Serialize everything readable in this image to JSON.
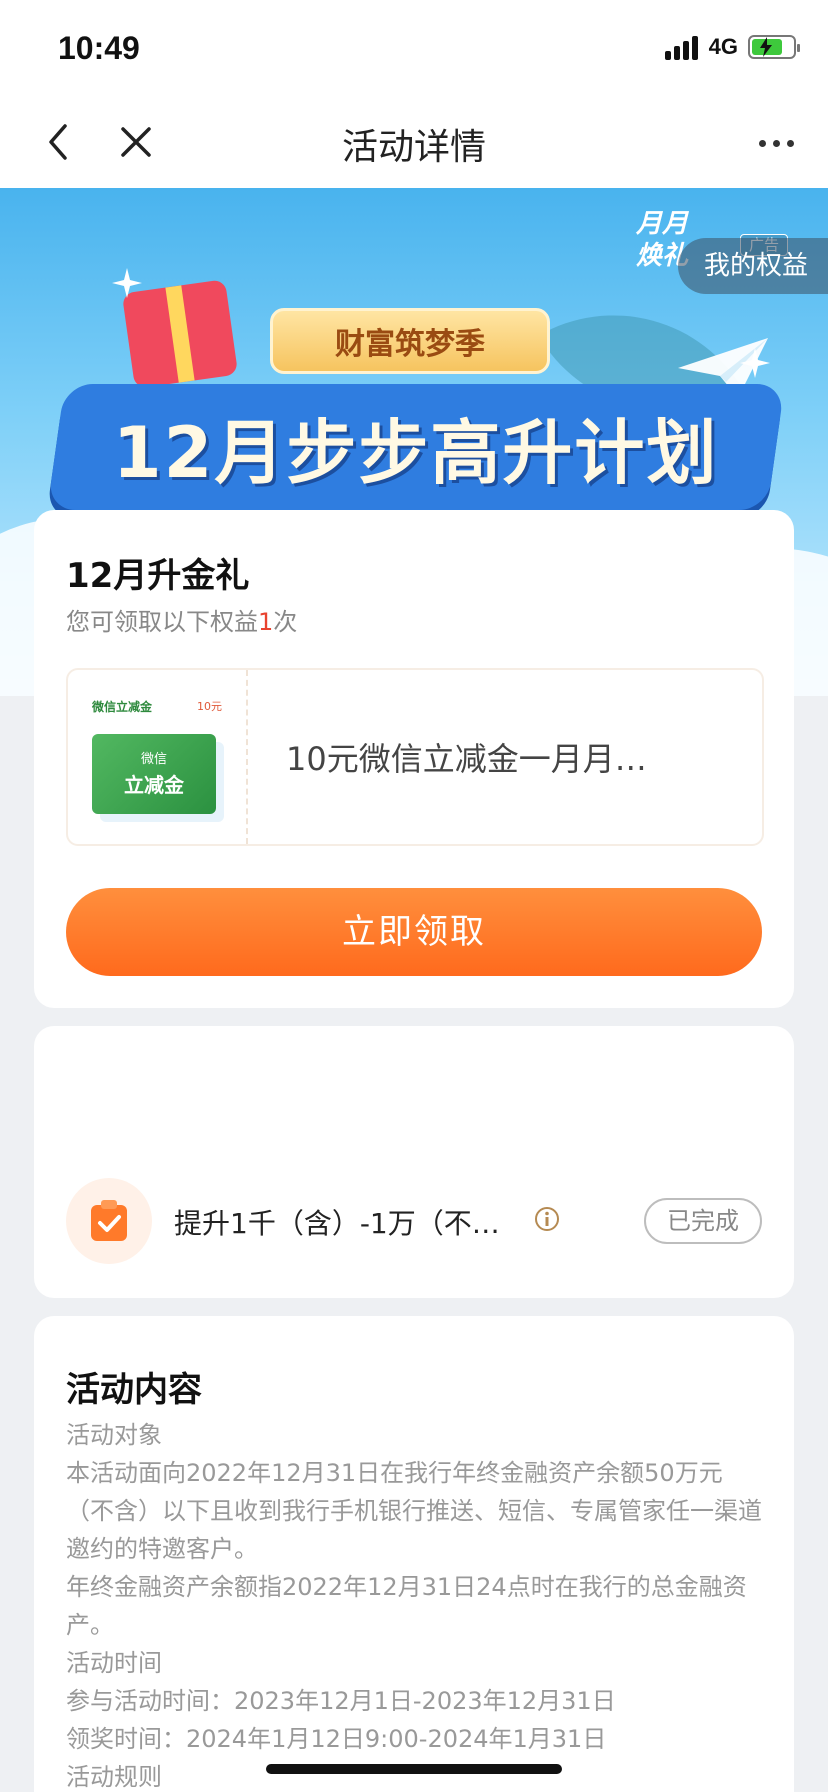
{
  "status_bar": {
    "time": "10:49",
    "network": "4G"
  },
  "nav": {
    "title": "活动详情"
  },
  "banner": {
    "ribbon": "财富筑梦季",
    "title": "12月步步高升计划",
    "brand_logo": "月月\n焕礼",
    "ad_tag": "广告",
    "rights_label": "我的权益"
  },
  "reward_card": {
    "title": "12月升金礼",
    "subtitle_prefix": "您可领取以下权益",
    "subtitle_count": "1",
    "subtitle_suffix": "次",
    "coupon": {
      "tiny_title": "微信立减金",
      "tiny_amount": "10元",
      "card_line1": "微信",
      "card_line2": "立减金",
      "name": "10元微信立减金一月月…"
    },
    "claim_label": "立即领取"
  },
  "task_card": {
    "task_text": "提升1千（含）-1万（不…",
    "status": "已完成"
  },
  "content_card": {
    "title": "活动内容",
    "lines": [
      "活动对象",
      "本活动面向2022年12月31日在我行年终金融资产余额50万元（不含）以下且收到我行手机银行推送、短信、专属管家任一渠道邀约的特邀客户。",
      "年终金融资产余额指2022年12月31日24点时在我行的总金融资产。",
      "活动时间",
      "参与活动时间：2023年12月1日-2023年12月31日",
      "领奖时间：2024年1月12日9:00-2024年1月31日",
      "活动规则"
    ]
  },
  "colors": {
    "accent_orange": "#ff7a2a",
    "highlight_red": "#e8432f",
    "banner_blue": "#49b3ee"
  }
}
